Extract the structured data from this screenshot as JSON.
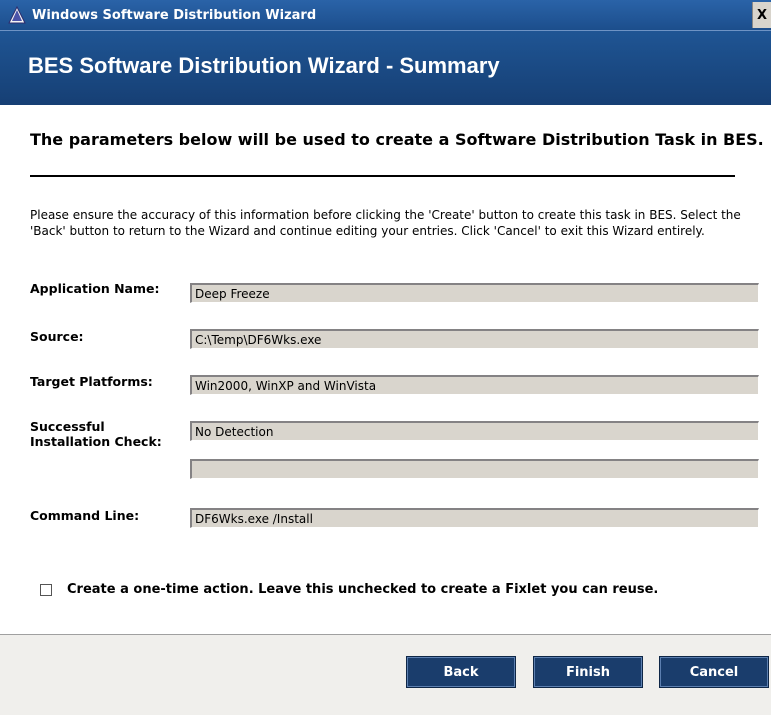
{
  "window": {
    "title": "Windows Software Distribution Wizard",
    "close_glyph": "X"
  },
  "banner": {
    "title": "BES Software Distribution Wizard - Summary"
  },
  "heading": "The parameters below will be used to create a Software Distribution Task in BES.",
  "instructions": "Please ensure the accuracy of this information before clicking the 'Create' button to create this task in BES. Select the 'Back' button to return to the Wizard and continue editing your entries. Click 'Cancel' to exit this Wizard entirely.",
  "fields": {
    "application_name": {
      "label": "Application Name:",
      "value": "Deep Freeze"
    },
    "source": {
      "label": "Source:",
      "value": "C:\\Temp\\DF6Wks.exe"
    },
    "target_platforms": {
      "label": "Target Platforms:",
      "value": "Win2000, WinXP and WinVista"
    },
    "installation_check": {
      "label_line1": "Successful",
      "label_line2": "Installation Check:",
      "value": "No Detection",
      "value2": ""
    },
    "command_line": {
      "label": "Command Line:",
      "value": "DF6Wks.exe /Install"
    }
  },
  "one_time_action": {
    "label": "Create a one-time action. Leave this unchecked to create a Fixlet you can reuse.",
    "checked": false
  },
  "buttons": {
    "back": "Back",
    "finish": "Finish",
    "cancel": "Cancel"
  },
  "colors": {
    "banner": "#1f5594",
    "button": "#1a3d6c",
    "field_bg": "#d9d5cd"
  },
  "icons": {
    "app": "warning-triangle-icon"
  }
}
